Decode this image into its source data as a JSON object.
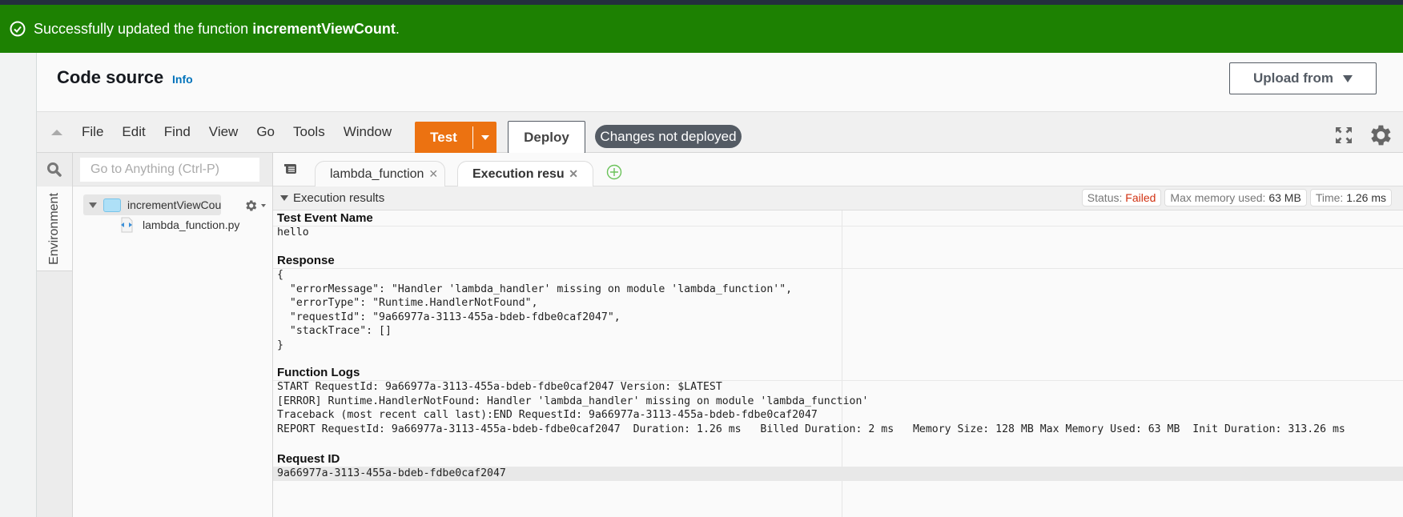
{
  "flash": {
    "icon": "check-circle-icon",
    "message_prefix": "Successfully updated the function ",
    "function_name": "incrementViewCount",
    "message_suffix": "."
  },
  "header": {
    "title": "Code source",
    "info_link": "Info",
    "upload_button": "Upload from"
  },
  "toolbar": {
    "menu": [
      "File",
      "Edit",
      "Find",
      "View",
      "Go",
      "Tools",
      "Window"
    ],
    "test_button": "Test",
    "deploy_button": "Deploy",
    "status_badge": "Changes not deployed"
  },
  "sidebar": {
    "env_tab": "Environment",
    "search_placeholder": "Go to Anything (Ctrl-P)",
    "folder": "incrementViewCount",
    "file": "lambda_function.py"
  },
  "tabs": [
    {
      "label": "lambda_function",
      "active": false
    },
    {
      "label": "Execution results",
      "active": true
    }
  ],
  "execution": {
    "header": "Execution results",
    "status_label": "Status: ",
    "status_value": "Failed",
    "memory_label": "Max memory used: ",
    "memory_value": "63 MB",
    "time_label": "Time: ",
    "time_value": "1.26 ms",
    "test_event_heading": "Test Event Name",
    "test_event_value": "hello",
    "response_heading": "Response",
    "response_lines": [
      "{",
      "  \"errorMessage\": \"Handler 'lambda_handler' missing on module 'lambda_function'\",",
      "  \"errorType\": \"Runtime.HandlerNotFound\",",
      "  \"requestId\": \"9a66977a-3113-455a-bdeb-fdbe0caf2047\",",
      "  \"stackTrace\": []",
      "}"
    ],
    "logs_heading": "Function Logs",
    "log_lines": [
      "START RequestId: 9a66977a-3113-455a-bdeb-fdbe0caf2047 Version: $LATEST",
      "[ERROR] Runtime.HandlerNotFound: Handler 'lambda_handler' missing on module 'lambda_function'",
      "Traceback (most recent call last):END RequestId: 9a66977a-3113-455a-bdeb-fdbe0caf2047",
      "REPORT RequestId: 9a66977a-3113-455a-bdeb-fdbe0caf2047  Duration: 1.26 ms   Billed Duration: 2 ms   Memory Size: 128 MB Max Memory Used: 63 MB  Init Duration: 313.26 ms"
    ],
    "request_id_heading": "Request ID",
    "request_id_value": "9a66977a-3113-455a-bdeb-fdbe0caf2047"
  },
  "colors": {
    "flash_bg": "#1d8102",
    "test_button": "#ec7211",
    "failed": "#d13212",
    "info_link": "#0073bb"
  }
}
